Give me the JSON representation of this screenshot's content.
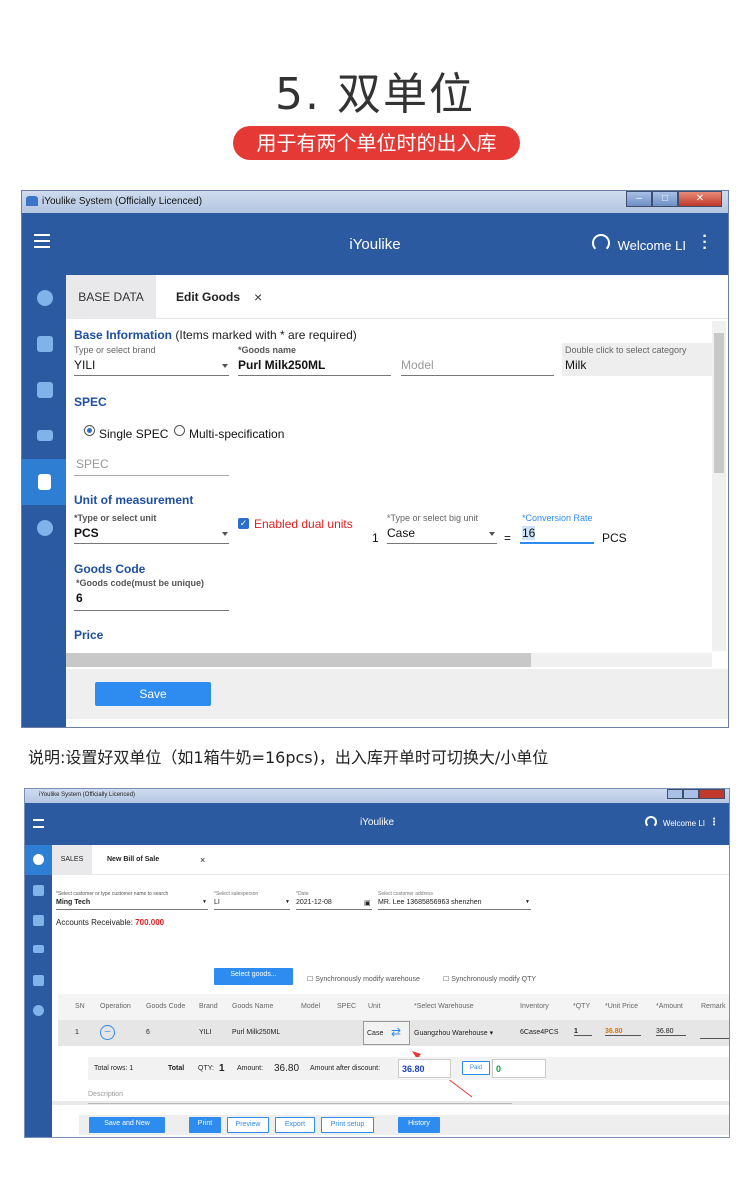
{
  "heading": "5. 双单位",
  "pill": "用于有两个单位时的出入库",
  "caption": "说明:设置好双单位（如1箱牛奶=16pcs)，出入库开单时可切换大/小单位",
  "win1": {
    "titlebar": "iYoulike System (Officially Licenced)",
    "app_title": "iYoulike",
    "welcome": "Welcome LI",
    "tabs": {
      "base": "BASE DATA",
      "edit": "Edit Goods",
      "close": "×"
    },
    "base_info": {
      "title": "Base Information",
      "note": "(Items marked with * are required)"
    },
    "brand": {
      "label": "Type or select brand",
      "value": "YILI"
    },
    "goods_name": {
      "label": "*Goods name",
      "value": "Purl Milk250ML"
    },
    "model_placeholder": "Model",
    "category": {
      "label": "Double click to select category",
      "value": "Milk"
    },
    "spec": {
      "title": "SPEC",
      "single": "Single SPEC",
      "multi": "Multi-specification",
      "placeholder": "SPEC"
    },
    "unit": {
      "title": "Unit of measurement",
      "unit_label": "*Type or select unit",
      "unit_value": "PCS",
      "dual": "Enabled dual units",
      "one": "1",
      "big_label": "*Type or select big unit",
      "big_value": "Case",
      "eq": "=",
      "rate_label": "*Conversion Rate",
      "rate_value": "16",
      "rate_unit": "PCS"
    },
    "goods_code": {
      "title": "Goods Code",
      "label": "*Goods code(must be unique)",
      "value": "6"
    },
    "price_title": "Price",
    "save": "Save",
    "colors": {
      "brand": "#2c5aa0",
      "accent": "#2e8cf0",
      "dual": "#e02020"
    },
    "icons": [
      "dashboard-icon",
      "bag-icon",
      "store-icon",
      "card-icon",
      "document-icon",
      "settings-icon"
    ]
  },
  "win2": {
    "titlebar": "iYoulike System (Officially Licenced)",
    "app_title": "iYoulike",
    "welcome": "Welcome LI",
    "tabs": {
      "sales": "SALES",
      "bill": "New Bill of Sale",
      "close": "×"
    },
    "customer": {
      "label": "*Select customer or type customer name to search",
      "value": "Ming Tech"
    },
    "salesperson": {
      "label": "*Select salesperson",
      "value": "LI"
    },
    "date": {
      "label": "*Date",
      "value": "2021-12-08"
    },
    "address": {
      "label": "Select customer address",
      "value": "MR. Lee 13685856963 shenzhen"
    },
    "receivable": {
      "label": "Accounts Receivable:",
      "value": "700.000"
    },
    "select_goods": "Select goods...",
    "sync_warehouse": "Synchronously modify warehouse",
    "sync_qty": "Synchronously modify QTY",
    "columns": [
      "SN",
      "Operation",
      "Goods Code",
      "Brand",
      "Goods Name",
      "Model",
      "SPEC",
      "Unit",
      "*Select Warehouse",
      "Inventory",
      "*QTY",
      "*Unit Price",
      "*Amount",
      "Remark"
    ],
    "row": {
      "sn": "1",
      "code": "6",
      "brand": "YILI",
      "name": "Purl Milk250ML",
      "unit": "Case",
      "warehouse": "Guangzhou Warehouse",
      "inventory": "6Case4PCS",
      "qty": "1",
      "price": "36.80",
      "amount": "36.80"
    },
    "footer": {
      "total_rows": "Total rows:  1",
      "total": "Total",
      "qty_label": "QTY:",
      "qty": "1",
      "amount_label": "Amount:",
      "amount": "36.80",
      "after_label": "Amount after discount:",
      "after": "36.80",
      "paid_label": "Paid",
      "paid": "0"
    },
    "description": "Description",
    "buttons": {
      "save_new": "Save and New",
      "print": "Print",
      "preview": "Preview",
      "export": "Export",
      "print_setup": "Print setup",
      "history": "History"
    }
  }
}
